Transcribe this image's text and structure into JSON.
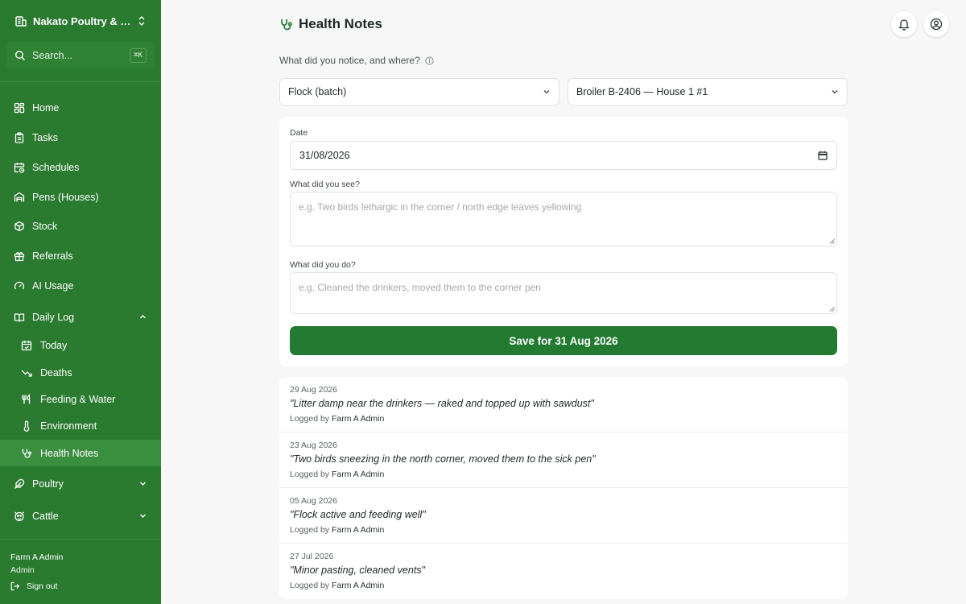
{
  "sidebar": {
    "farm_name": "Nakato Poultry & Da...",
    "search_placeholder": "Search...",
    "search_shortcut": "⌘K",
    "nav": [
      {
        "label": "Home",
        "icon": "grid-icon"
      },
      {
        "label": "Tasks",
        "icon": "clipboard-icon"
      },
      {
        "label": "Schedules",
        "icon": "calendar-clock-icon"
      },
      {
        "label": "Pens (Houses)",
        "icon": "warehouse-icon"
      },
      {
        "label": "Stock",
        "icon": "box-icon"
      },
      {
        "label": "Referrals",
        "icon": "gift-icon"
      },
      {
        "label": "AI Usage",
        "icon": "gauge-icon"
      }
    ],
    "daily_log": {
      "label": "Daily Log",
      "icon": "book-open-icon",
      "expanded": true,
      "items": [
        {
          "label": "Today",
          "icon": "calendar-check-icon"
        },
        {
          "label": "Deaths",
          "icon": "trending-down-icon"
        },
        {
          "label": "Feeding & Water",
          "icon": "utensils-icon"
        },
        {
          "label": "Environment",
          "icon": "thermometer-icon"
        },
        {
          "label": "Health Notes",
          "icon": "stethoscope-icon",
          "active": true
        }
      ]
    },
    "groups": [
      {
        "label": "Poultry",
        "icon": "feather-icon"
      },
      {
        "label": "Cattle",
        "icon": "cattle-icon"
      }
    ],
    "user": {
      "name": "Farm A Admin",
      "role": "Admin"
    },
    "sign_out": "Sign out"
  },
  "header": {
    "title": "Health Notes",
    "icon": "stethoscope-icon",
    "notifications_icon": "bell-icon",
    "profile_icon": "user-circle-icon"
  },
  "form": {
    "question": "What did you notice, and where?",
    "target_type": "Flock (batch)",
    "target": "Broiler B-2406 — House 1 #1",
    "date_label": "Date",
    "date_value": "31/08/2026",
    "saw_label": "What did you see?",
    "saw_placeholder": "e.g. Two birds lethargic in the corner / north edge leaves yellowing",
    "did_label": "What did you do?",
    "did_placeholder": "e.g. Cleaned the drinkers, moved them to the corner pen",
    "save_label": "Save for 31 Aug 2026"
  },
  "history": [
    {
      "date": "29 Aug 2026",
      "text": "\"Litter damp near the drinkers — raked and topped up with sawdust\"",
      "logged_by_label": "Logged by",
      "by": "Farm A Admin"
    },
    {
      "date": "23 Aug 2026",
      "text": "\"Two birds sneezing in the north corner, moved them to the sick pen\"",
      "logged_by_label": "Logged by",
      "by": "Farm A Admin"
    },
    {
      "date": "05 Aug 2026",
      "text": "\"Flock active and feeding well\"",
      "logged_by_label": "Logged by",
      "by": "Farm A Admin"
    },
    {
      "date": "27 Jul 2026",
      "text": "\"Minor pasting, cleaned vents\"",
      "logged_by_label": "Logged by",
      "by": "Farm A Admin"
    }
  ],
  "colors": {
    "sidebar_bg": "#2a7a2f",
    "sidebar_active": "#3a8f3f",
    "primary_button": "#237a31",
    "page_bg": "#f6f7f6"
  }
}
